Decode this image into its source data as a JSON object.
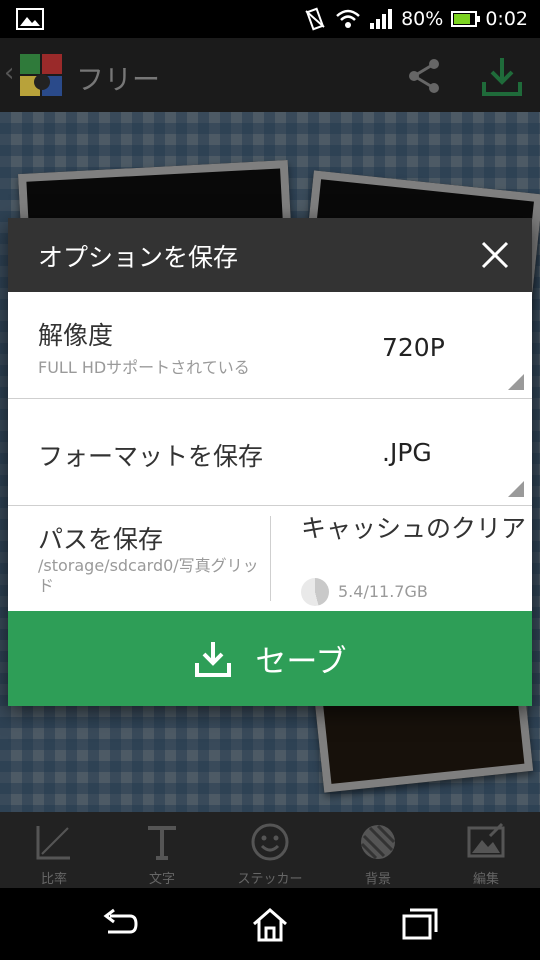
{
  "status_bar": {
    "battery": "80%",
    "time": "0:02",
    "battery_level": 0.8
  },
  "app_bar": {
    "title": "フリー"
  },
  "dialog": {
    "title": "オプションを保存",
    "resolution": {
      "label": "解像度",
      "sub": "FULL HDサポートされている",
      "value": "720P"
    },
    "format": {
      "label": "フォーマットを保存",
      "value": ".JPG"
    },
    "path": {
      "label": "パスを保存",
      "value": "/storage/sdcard0/写真グリッド"
    },
    "cache": {
      "label": "キャッシュのクリア",
      "value": "5.4/11.7GB"
    },
    "save_label": "セーブ"
  },
  "toolbar": {
    "items": [
      {
        "label": "比率",
        "icon": "ratio-icon"
      },
      {
        "label": "文字",
        "icon": "text-icon"
      },
      {
        "label": "ステッカー",
        "icon": "sticker-icon"
      },
      {
        "label": "背景",
        "icon": "background-icon"
      },
      {
        "label": "編集",
        "icon": "edit-icon"
      }
    ]
  },
  "colors": {
    "accent_green": "#2e9e57",
    "dialog_header": "#333333"
  }
}
